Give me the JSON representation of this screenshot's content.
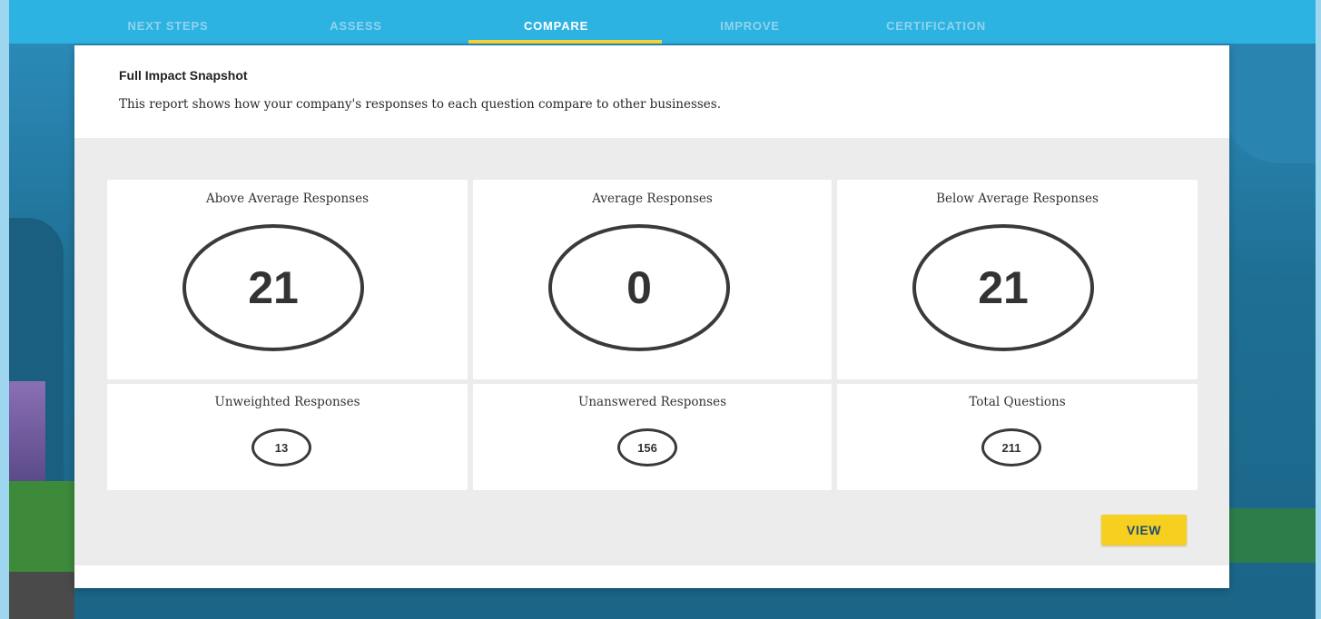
{
  "nav": {
    "tabs": [
      {
        "label": "NEXT STEPS",
        "active": false
      },
      {
        "label": "ASSESS",
        "active": false
      },
      {
        "label": "COMPARE",
        "active": true
      },
      {
        "label": "IMPROVE",
        "active": false
      },
      {
        "label": "CERTIFICATION",
        "active": false
      }
    ]
  },
  "report": {
    "title": "Full Impact Snapshot",
    "description": "This report shows how your company's responses to each question compare to other businesses."
  },
  "stats": {
    "above_average": {
      "label": "Above Average Responses",
      "value": "21"
    },
    "average": {
      "label": "Average Responses",
      "value": "0"
    },
    "below_average": {
      "label": "Below Average Responses",
      "value": "21"
    },
    "unweighted": {
      "label": "Unweighted Responses",
      "value": "13"
    },
    "unanswered": {
      "label": "Unanswered Responses",
      "value": "156"
    },
    "total_questions": {
      "label": "Total Questions",
      "value": "211"
    }
  },
  "actions": {
    "view_label": "VIEW"
  },
  "colors": {
    "nav_background": "#2db3e2",
    "nav_active_underline": "#f4d53a",
    "view_button": "#f7cf1f",
    "view_button_text": "#1d4f73",
    "panel_background": "#ececec"
  }
}
